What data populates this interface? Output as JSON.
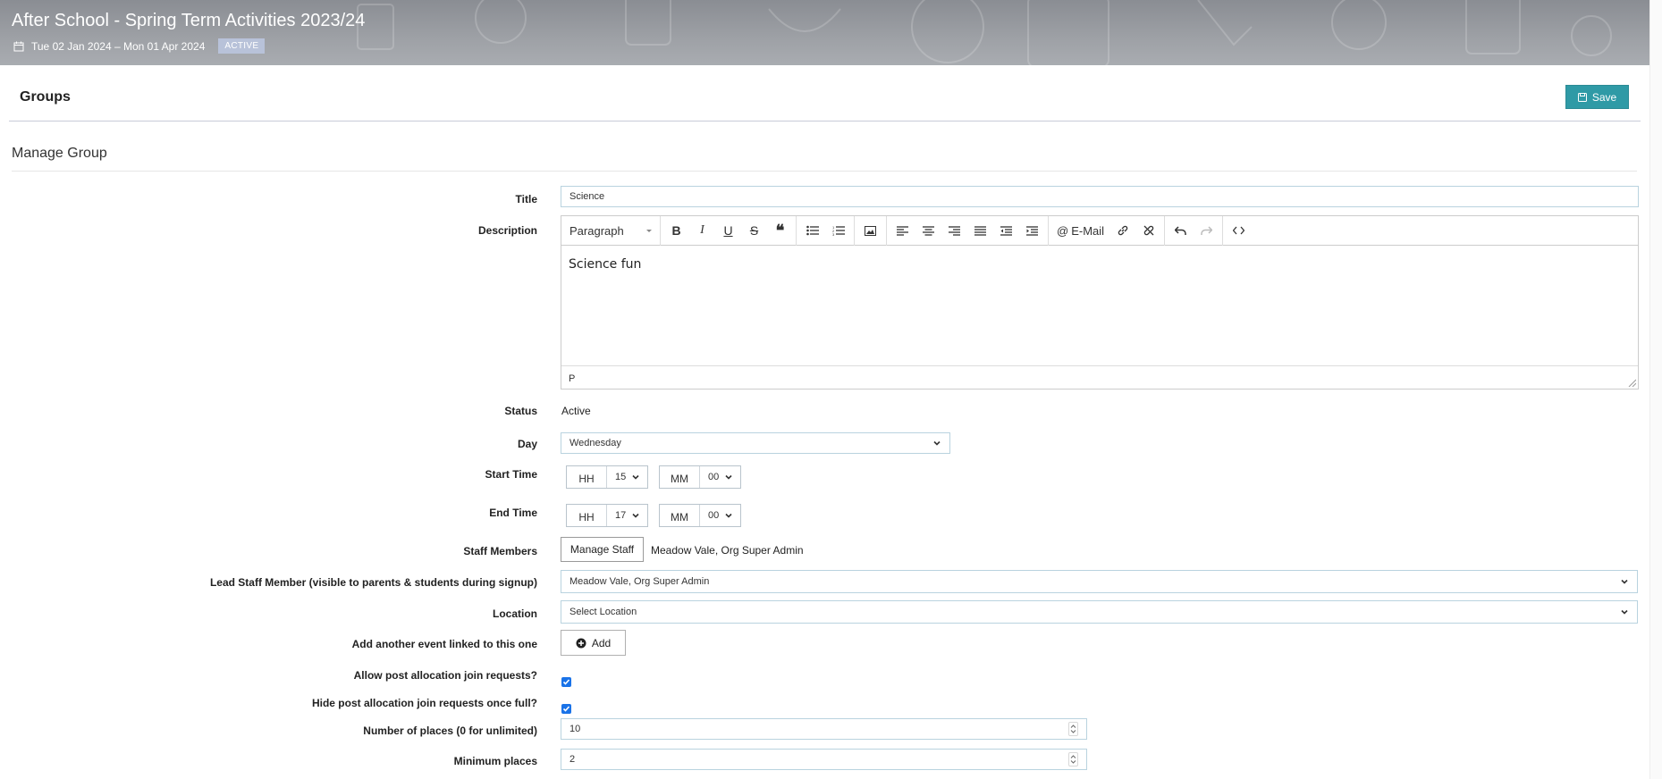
{
  "header": {
    "title": "After School - Spring Term Activities 2023/24",
    "date_range": "Tue 02 Jan 2024 – Mon 01 Apr 2024",
    "status_badge": "ACTIVE"
  },
  "groups_bar": {
    "title": "Groups",
    "save_label": "Save",
    "accent_color": "#2f9aa6"
  },
  "section": {
    "title": "Manage Group"
  },
  "form": {
    "title_label": "Title",
    "title_value": "Science",
    "description_label": "Description",
    "editor": {
      "format_select": "Paragraph",
      "email_label": "E-Mail",
      "content": "Science fun",
      "status_path": "P",
      "icons": [
        "bold-icon",
        "italic-icon",
        "underline-icon",
        "strikethrough-icon",
        "blockquote-icon",
        "bullet-list-icon",
        "numbered-list-icon",
        "image-icon",
        "align-left-icon",
        "align-center-icon",
        "align-right-icon",
        "align-justify-icon",
        "outdent-icon",
        "indent-icon",
        "email-icon",
        "link-icon",
        "unlink-icon",
        "undo-icon",
        "redo-icon",
        "source-code-icon"
      ]
    },
    "status_label": "Status",
    "status_value": "Active",
    "day_label": "Day",
    "day_value": "Wednesday",
    "start_time_label": "Start Time",
    "start_hh_label": "HH",
    "start_hh_value": "15",
    "start_mm_label": "MM",
    "start_mm_value": "00",
    "end_time_label": "End Time",
    "end_hh_label": "HH",
    "end_hh_value": "17",
    "end_mm_label": "MM",
    "end_mm_value": "00",
    "staff_label": "Staff Members",
    "manage_staff_button": "Manage Staff",
    "staff_value": "Meadow Vale, Org Super Admin",
    "lead_staff_label": "Lead Staff Member (visible to parents & students during signup)",
    "lead_staff_value": "Meadow Vale, Org Super Admin",
    "location_label": "Location",
    "location_value": "Select Location",
    "linked_event_label": "Add another event linked to this one",
    "add_button": "Add",
    "allow_join_label": "Allow post allocation join requests?",
    "allow_join_checked": true,
    "hide_join_label": "Hide post allocation join requests once full?",
    "hide_join_checked": true,
    "places_label": "Number of places (0 for unlimited)",
    "places_value": "10",
    "min_places_label": "Minimum places",
    "min_places_value": "2"
  }
}
